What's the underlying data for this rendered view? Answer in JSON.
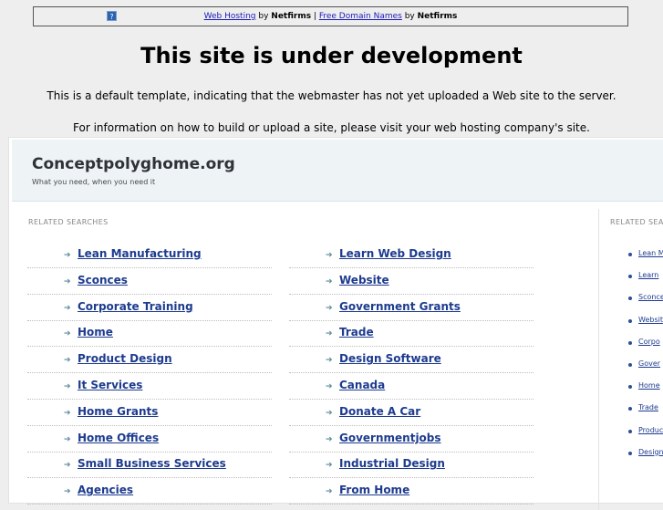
{
  "banner": {
    "help_icon": "question-icon",
    "link1": "Web Hosting",
    "by1": " by ",
    "brand1": "Netfirms",
    "sep": " | ",
    "link2": "Free Domain Names",
    "by2": " by ",
    "brand2": "Netfirms"
  },
  "notice": {
    "title": "This site is under development",
    "line1": "This is a default template, indicating that the webmaster has not yet uploaded a Web site to the server.",
    "line2": "For information on how to build or upload a site, please visit your web hosting company's site."
  },
  "site": {
    "name": "Conceptpolyghome.org",
    "tagline": "What you need, when you need it",
    "head_mark": "4"
  },
  "related": {
    "label": "RELATED SEARCHES",
    "right_label": "RELATED SEA",
    "left_column": [
      "Lean Manufacturing",
      "Sconces",
      "Corporate Training",
      "Home",
      "Product Design",
      "It Services",
      "Home Grants",
      "Home Offices",
      "Small Business Services",
      "Agencies"
    ],
    "right_column": [
      "Learn Web Design",
      "Website",
      "Government Grants",
      "Trade",
      "Design Software",
      "Canada",
      "Donate A Car",
      "Governmentjobs",
      "Industrial Design",
      "From Home"
    ],
    "side_column": [
      "Lean M",
      "Learn",
      "Sconce",
      "Websit",
      "Corpo",
      "Gover",
      "Home",
      "Trade",
      "Produc",
      "Design"
    ]
  },
  "colors": {
    "link": "#1d3b8f",
    "arrow": "#5a8a9a",
    "header_bg": "#eef3f5",
    "page_bg": "#eeeeee"
  }
}
